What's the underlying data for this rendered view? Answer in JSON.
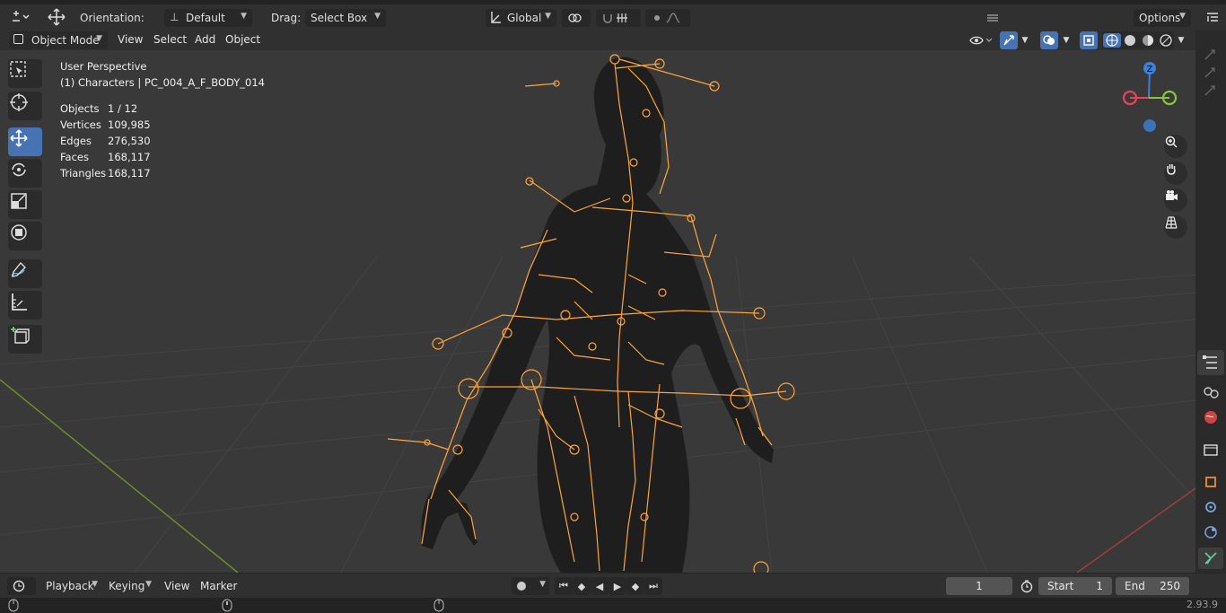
{
  "top_header": {
    "orientation_label": "Orientation:",
    "orientation_value": "Default",
    "drag_label": "Drag:",
    "drag_value": "Select Box",
    "transform_space": "Global",
    "options_label": "Options"
  },
  "viewport_header": {
    "mode": "Object Mode",
    "menus": [
      "View",
      "Select",
      "Add",
      "Object"
    ]
  },
  "overlay": {
    "perspective": "User Perspective",
    "collection": "(1) Characters | PC_004_A_F_BODY_014",
    "stats": [
      {
        "label": "Objects",
        "value": "1 / 12"
      },
      {
        "label": "Vertices",
        "value": "109,985"
      },
      {
        "label": "Edges",
        "value": "276,530"
      },
      {
        "label": "Faces",
        "value": "168,117"
      },
      {
        "label": "Triangles",
        "value": "168,117"
      }
    ]
  },
  "gizmo": {
    "z_label": "Z",
    "x_color": "#e8455b",
    "y_color": "#8ac43a",
    "z_color": "#3c82d6"
  },
  "timeline": {
    "menus": [
      "Playback",
      "Keying",
      "View",
      "Marker"
    ],
    "current_frame": "1",
    "start_label": "Start",
    "start_value": "1",
    "end_label": "End",
    "end_value": "250"
  },
  "status": {
    "version": "2.93.9"
  },
  "colors": {
    "accent": "#4772b3",
    "armature": "#ffa53a"
  }
}
